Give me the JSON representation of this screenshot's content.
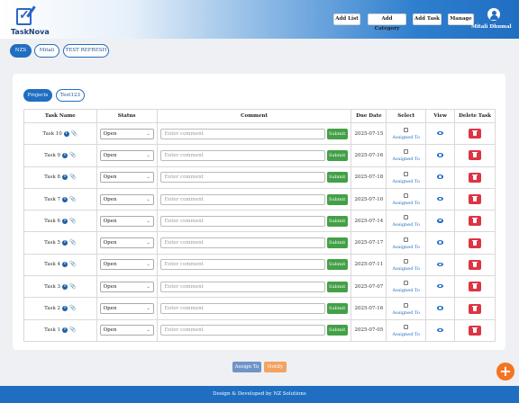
{
  "app": {
    "name": "TaskNova"
  },
  "header": {
    "buttons": [
      "Add List",
      "Add Category",
      "Add Task",
      "Manage"
    ],
    "user_name": "Mitali Dhumal"
  },
  "lists": [
    "NZS",
    "Mitali",
    "TEST REFRESH"
  ],
  "active_list": "NZS",
  "categories": [
    "Projects",
    "Test123"
  ],
  "active_category": "Projects",
  "table": {
    "headers": [
      "Task Name",
      "Status",
      "Comment",
      "Due Date",
      "Select",
      "View",
      "Delete Task"
    ],
    "comment_placeholder": "Enter comment",
    "submit_label": "Submit",
    "assigned_label": "Assigned To",
    "rows": [
      {
        "name": "Task 10",
        "status": "Open",
        "due": "2025-07-15"
      },
      {
        "name": "Task 9",
        "status": "Open",
        "due": "2025-07-16"
      },
      {
        "name": "Task 8",
        "status": "Open",
        "due": "2025-07-18"
      },
      {
        "name": "Task 7",
        "status": "Open",
        "due": "2025-07-10"
      },
      {
        "name": "Task 6",
        "status": "Open",
        "due": "2025-07-14"
      },
      {
        "name": "Task 5",
        "status": "Open",
        "due": "2025-07-17"
      },
      {
        "name": "Task 4",
        "status": "Open",
        "due": "2025-07-11"
      },
      {
        "name": "Task 3",
        "status": "Open",
        "due": "2025-07-07"
      },
      {
        "name": "Task 2",
        "status": "Open",
        "due": "2025-07-16"
      },
      {
        "name": "Task 1",
        "status": "Open",
        "due": "2025-07-05"
      }
    ]
  },
  "actions": {
    "assign": "Assign To",
    "notify": "Notify",
    "fab": "+"
  },
  "footer": {
    "text": "Design & Developed by NZ Solutions"
  },
  "icons": {
    "info": "info-icon",
    "attach": "paperclip-icon",
    "view": "eye-icon",
    "delete": "trash-icon",
    "avatar": "user-icon",
    "add": "plus-icon"
  },
  "colors": {
    "primary": "#1f6ec2",
    "submit": "#43a047",
    "delete": "#dc3545",
    "notify": "#f4a261",
    "assign": "#6f94c8",
    "fab": "#f47421"
  }
}
